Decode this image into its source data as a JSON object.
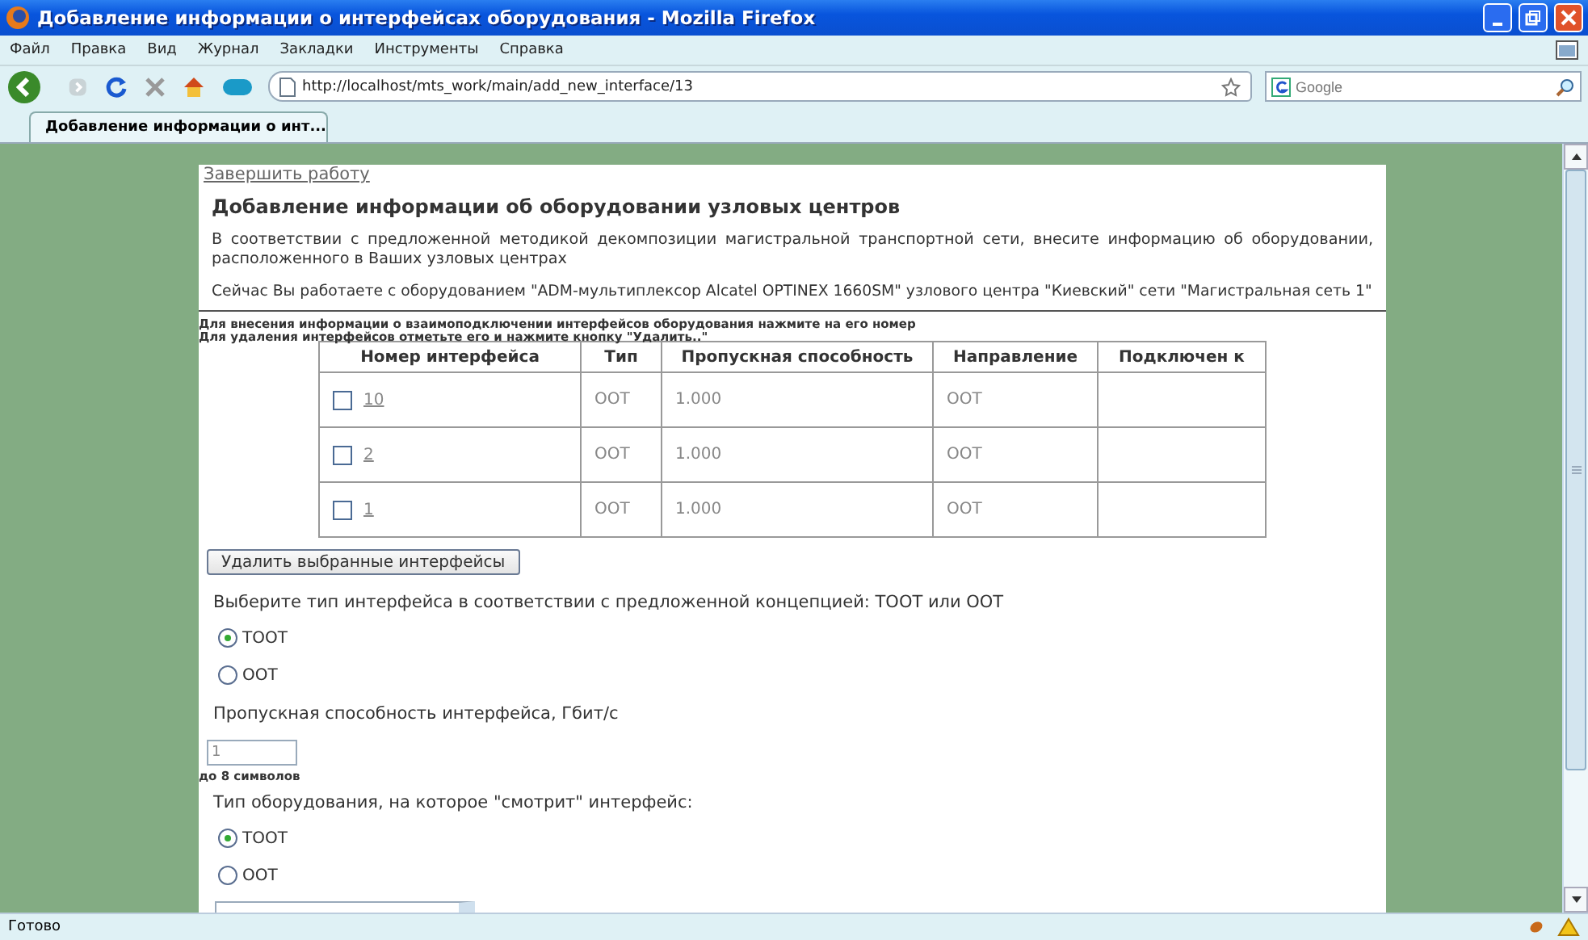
{
  "window": {
    "title": "Добавление информации о интерфейсах оборудования - Mozilla Firefox"
  },
  "menu": [
    "Файл",
    "Правка",
    "Вид",
    "Журнал",
    "Закладки",
    "Инструменты",
    "Справка"
  ],
  "navbar": {
    "url": "http://localhost/mts_work/main/add_new_interface/13",
    "search_placeholder": "Google"
  },
  "tabs": [
    {
      "label": "Добавление информации о инт...",
      "selected": true
    }
  ],
  "page": {
    "logout_link": "Завершить работу",
    "heading": "Добавление информации об оборудовании узловых центров",
    "intro": "В соответствии с предложенной методикой декомпозиции магистральной транспортной сети, внесите информацию об оборудовании, расположенного в Ваших узловых центрах",
    "current": "Сейчас Вы работаете с оборудованием \"ADM-мультиплексор Alcatel OPTINEX 1660SM\" узлового центра \"Киевский\" сети \"Магистральная сеть 1\"",
    "hints": [
      "Для внесения информации о взаимоподключении интерфейсов оборудования нажмите на его номер",
      "Для удаления интерфейсов отметьте его и нажмите кнопку \"Удалить..\""
    ],
    "table": {
      "columns": [
        "Номер интерфейса",
        "Тип",
        "Пропускная способность",
        "Направление",
        "Подключен к"
      ],
      "rows": [
        {
          "number": "10",
          "checked": false,
          "type": "OOT",
          "bandwidth": "1.000",
          "direction": "OOT"
        },
        {
          "number": "2",
          "checked": false,
          "type": "OOT",
          "bandwidth": "1.000",
          "direction": "OOT"
        },
        {
          "number": "1",
          "checked": false,
          "type": "OOT",
          "bandwidth": "1.000",
          "direction": "OOT"
        }
      ]
    },
    "delete_button": "Удалить выбранные интерфейсы",
    "interface_type": {
      "label": "Выберите тип интерфейса в соответствии с предложенной концепцией: TOOT или OOT",
      "options": [
        {
          "label": "TOOT",
          "selected": true
        },
        {
          "label": "OOT",
          "selected": false
        }
      ]
    },
    "bandwidth": {
      "label": "Пропускная способность интерфейса, Гбит/с",
      "value": "1",
      "hint": "до 8 символов"
    },
    "equipment_type": {
      "label": "Тип оборудования, на которое \"смотрит\" интерфейс:",
      "options": [
        {
          "label": "TOOT",
          "selected": true
        },
        {
          "label": "OOT",
          "selected": false
        }
      ]
    }
  },
  "status_bar": {
    "text": "Готово"
  }
}
